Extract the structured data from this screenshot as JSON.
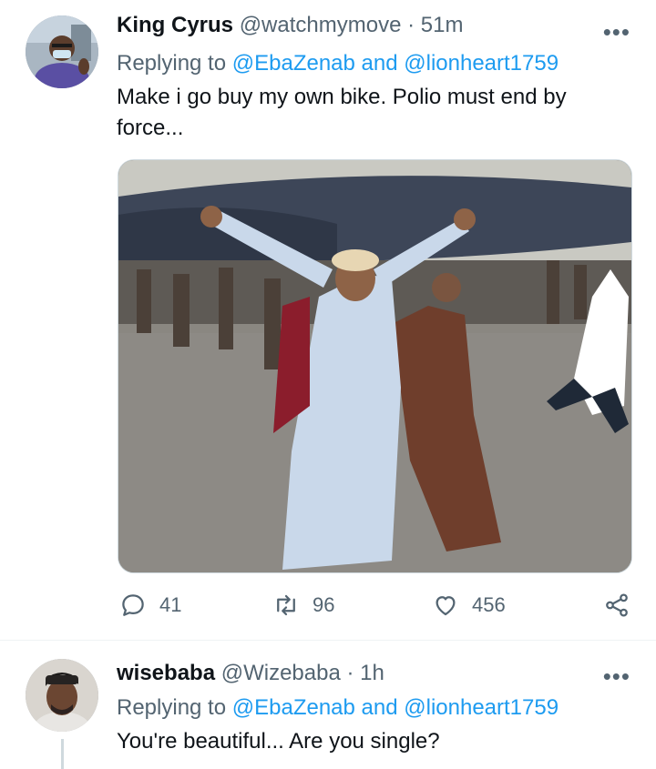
{
  "tweets": [
    {
      "name": "King Cyrus",
      "handle": "@watchmymove",
      "sep": "·",
      "time": "51m",
      "replying_prefix": "Replying to",
      "replying_to": "@EbaZenab and @lionheart1759",
      "text_line1": "Make i go buy my own bike. Polio must end by",
      "text_line2": "force...",
      "actions": {
        "replies": "41",
        "retweets": "96",
        "likes": "456"
      }
    },
    {
      "name": "wisebaba",
      "handle": "@Wizebaba",
      "sep": "·",
      "time": "1h",
      "replying_prefix": "Replying to",
      "replying_to": "@EbaZenab and @lionheart1759",
      "text_line1": "You're beautiful... Are you single?"
    }
  ],
  "more_glyph": "•••",
  "icons": {
    "reply": "reply-icon",
    "retweet": "retweet-icon",
    "like": "heart-icon",
    "share": "share-icon",
    "more": "more-icon"
  },
  "colors": {
    "link": "#1d9bf0",
    "muted": "#536471",
    "text": "#0f1419"
  }
}
